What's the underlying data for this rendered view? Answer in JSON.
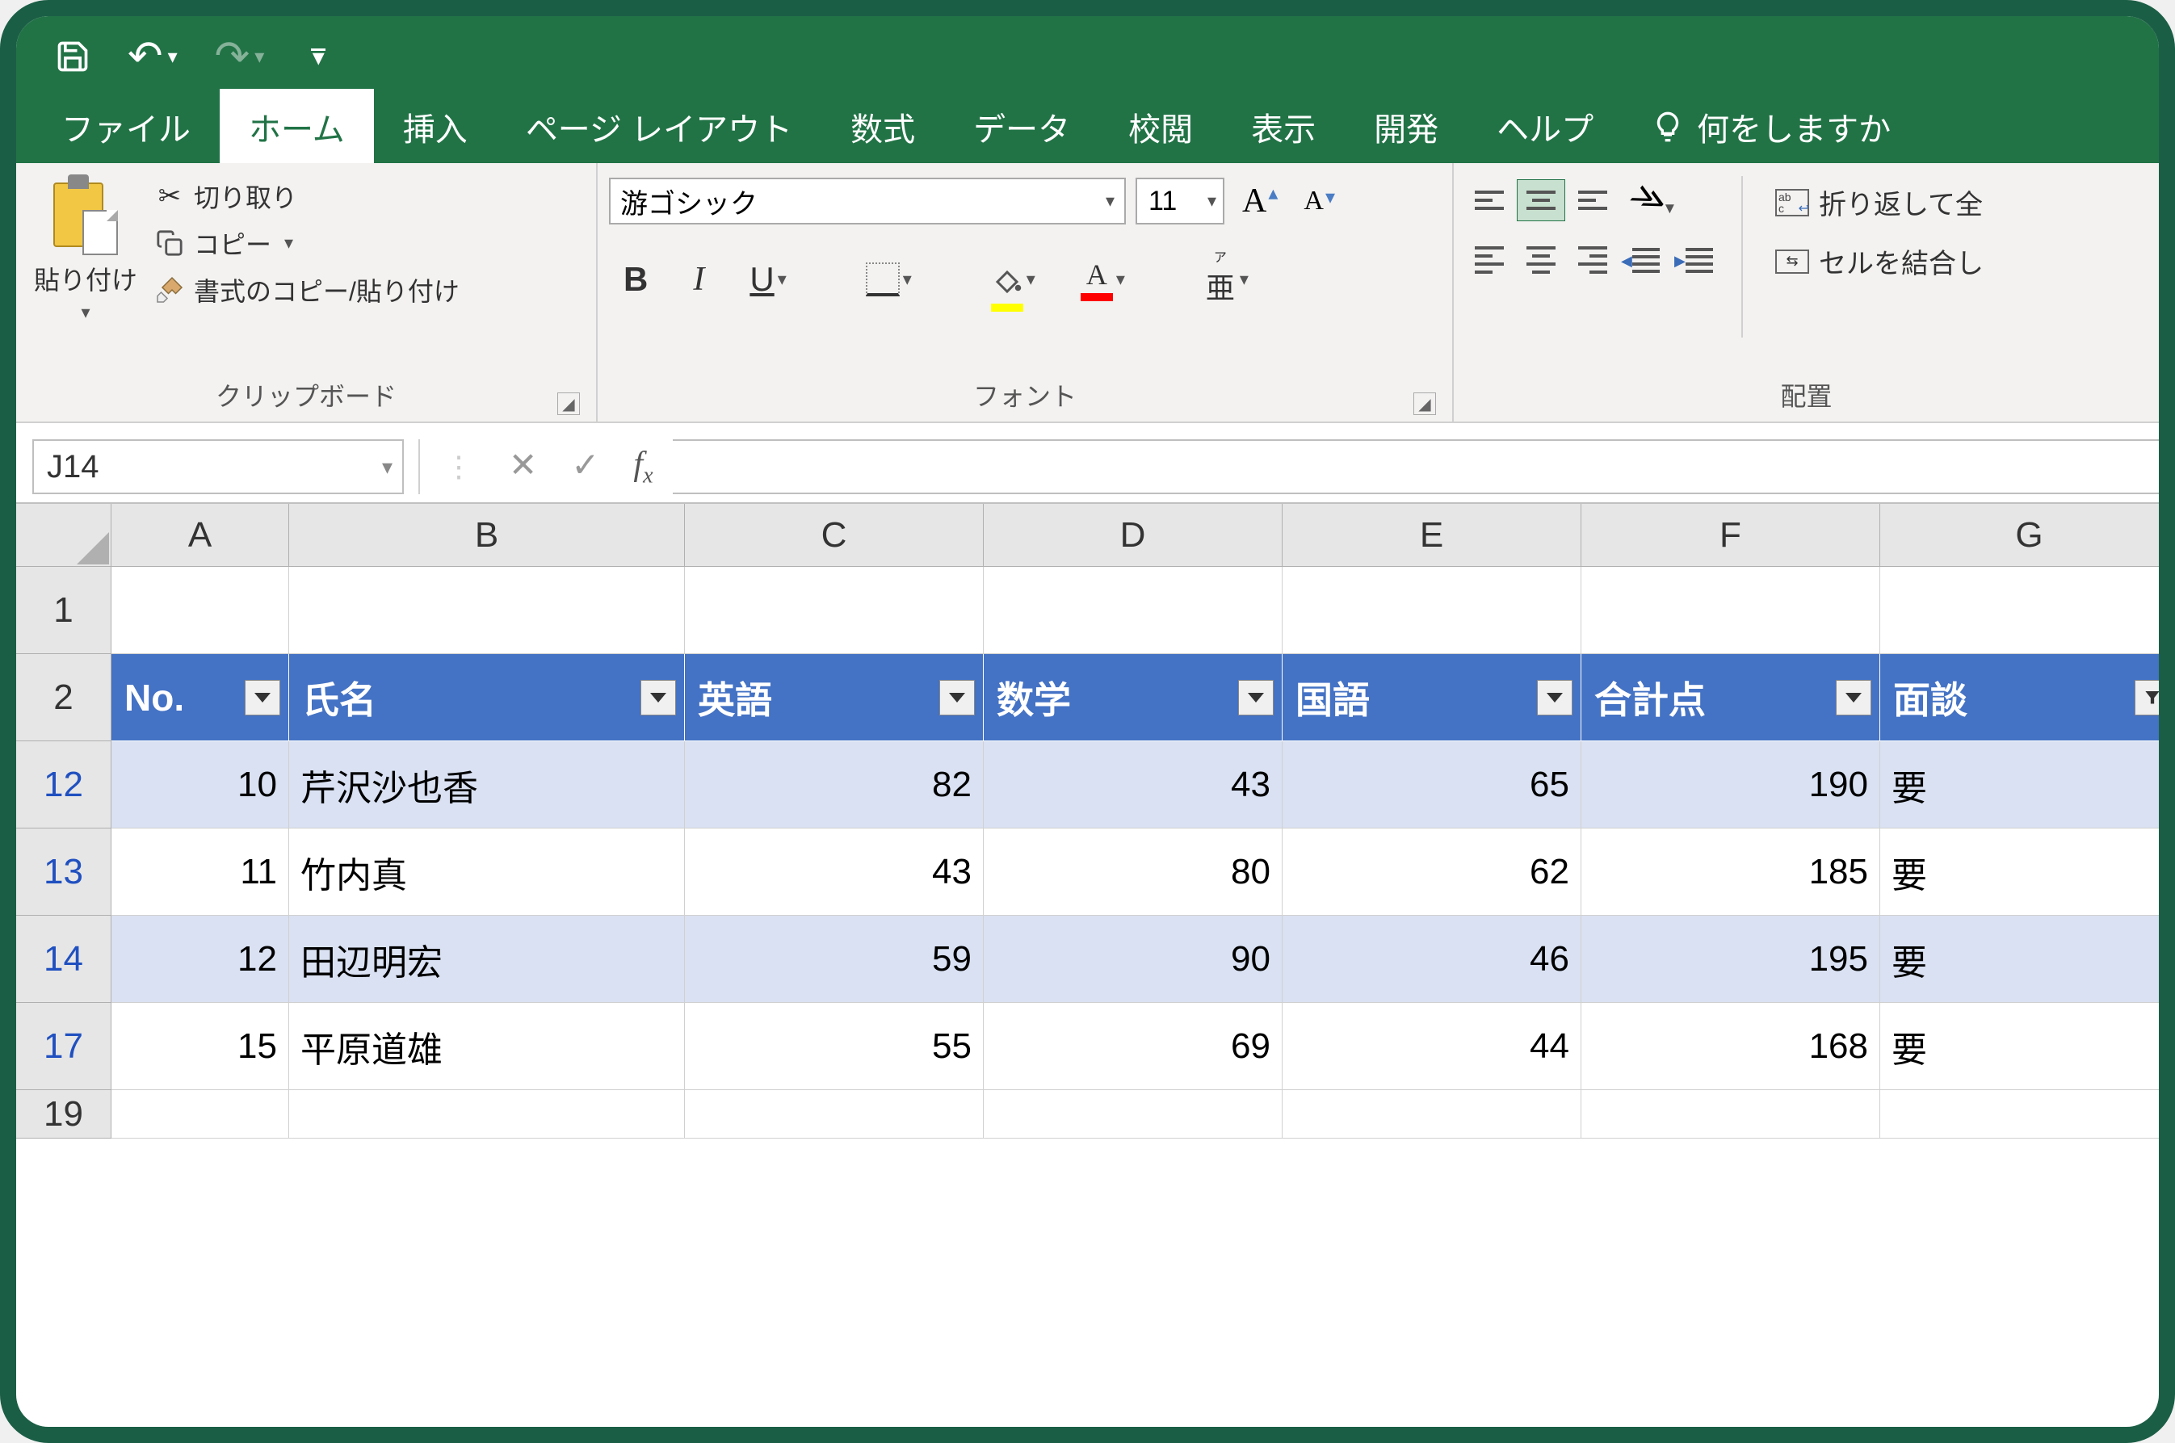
{
  "qat": {
    "save": "💾",
    "undo": "↶",
    "redo": "↷"
  },
  "tabs": {
    "file": "ファイル",
    "home": "ホーム",
    "insert": "挿入",
    "pagelayout": "ページ レイアウト",
    "formulas": "数式",
    "data": "データ",
    "review": "校閲",
    "view": "表示",
    "developer": "開発",
    "help": "ヘルプ",
    "tellme": "何をしますか"
  },
  "ribbon": {
    "clipboard": {
      "paste": "貼り付け",
      "cut": "切り取り",
      "copy": "コピー",
      "formatpainter": "書式のコピー/貼り付け",
      "label": "クリップボード"
    },
    "font": {
      "name": "游ゴシック",
      "size": "11",
      "bold": "B",
      "italic": "I",
      "underline": "U",
      "colorletter": "A",
      "phoneticbig": "亜",
      "phoneticruby": "ア",
      "label": "フォント"
    },
    "alignment": {
      "wraptext": "折り返して全",
      "mergecenter": "セルを結合し",
      "label": "配置"
    }
  },
  "namebox": "J14",
  "columns": [
    "A",
    "B",
    "C",
    "D",
    "E",
    "F",
    "G"
  ],
  "empty_row_header": "1",
  "table_row_header": "2",
  "last_empty_row_header": "19",
  "table": {
    "headers": [
      "No.",
      "氏名",
      "英語",
      "数学",
      "国語",
      "合計点",
      "面談"
    ],
    "rows": [
      {
        "rh": "12",
        "no": "10",
        "name": "芹沢沙也香",
        "eng": "82",
        "math": "43",
        "jpn": "65",
        "total": "190",
        "interview": "要",
        "striped": true
      },
      {
        "rh": "13",
        "no": "11",
        "name": "竹内真",
        "eng": "43",
        "math": "80",
        "jpn": "62",
        "total": "185",
        "interview": "要",
        "striped": false
      },
      {
        "rh": "14",
        "no": "12",
        "name": "田辺明宏",
        "eng": "59",
        "math": "90",
        "jpn": "46",
        "total": "195",
        "interview": "要",
        "striped": true
      },
      {
        "rh": "17",
        "no": "15",
        "name": "平原道雄",
        "eng": "55",
        "math": "69",
        "jpn": "44",
        "total": "168",
        "interview": "要",
        "striped": false
      }
    ]
  }
}
